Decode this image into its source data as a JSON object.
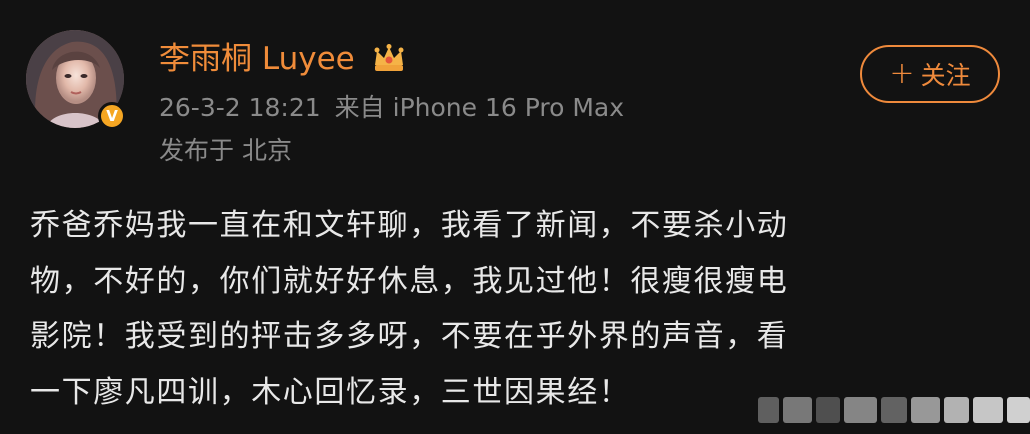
{
  "post": {
    "author": {
      "name": "李雨桐 Luyee",
      "verified": true,
      "badge_icon": "crown-icon",
      "verified_icon": "v-badge-icon"
    },
    "meta": {
      "time": "26-3-2 18:21",
      "source": "来自 iPhone 16 Pro Max",
      "location": "发布于 北京"
    },
    "follow_button": {
      "icon": "+",
      "label": "关注"
    },
    "body_lines": [
      "乔爸乔妈我一直在和文轩聊，我看了新闻，不要杀小动",
      "物，不好的，你们就好好休息，我见过他！很瘦很瘦电",
      "影院！我受到的抨击多多呀，不要在乎外界的声音，看",
      "一下廖凡四训，木心回忆录，三世因果经！"
    ]
  },
  "colors": {
    "background": "#121212",
    "accent": "#ef8a3c",
    "username": "#f08c3a",
    "meta_text": "#8a8a8a",
    "body_text": "#e8e8e8",
    "verified_badge": "#f5a623"
  }
}
